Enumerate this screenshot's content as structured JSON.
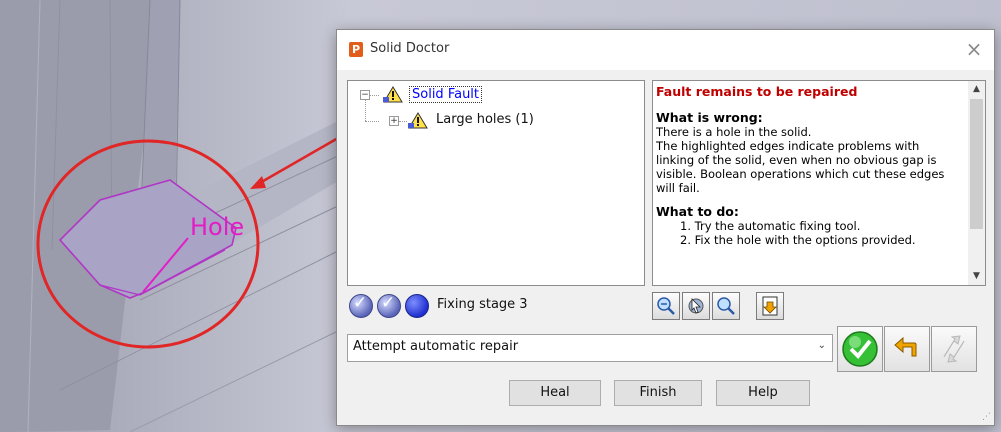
{
  "viewport": {
    "annotation_label": "Hole",
    "colors": {
      "annotation": "#e21ec5",
      "arrow": "#e02626",
      "circle": "#e02626",
      "model": "#c9cad6"
    }
  },
  "dialog": {
    "title": "Solid Doctor",
    "app_icon": "P",
    "close_icon": "×",
    "tree": {
      "root": {
        "label": "Solid Fault",
        "icon": "warning-icon",
        "expander": "−"
      },
      "children": [
        {
          "label": "Large holes (1)",
          "icon": "warning-icon",
          "expander": "+"
        }
      ]
    },
    "info": {
      "title": "Fault remains to be repaired",
      "what_is_wrong_heading": "What is wrong:",
      "what_is_wrong_lines": [
        "There is a hole in the solid.",
        "The highlighted edges indicate problems with linking of the solid, even when no obvious gap is visible. Boolean operations which cut these edges will fail."
      ],
      "what_to_do_heading": "What to do:",
      "what_to_do_items": [
        "1. Try the automatic fixing tool.",
        "2. Fix the hole with the options provided."
      ]
    },
    "stages": {
      "label": "Fixing stage 3",
      "icons": [
        "stage-complete-icon",
        "stage-complete-icon",
        "stage-current-icon"
      ]
    },
    "tools": [
      "zoom-out-icon",
      "select-view-icon",
      "zoom-icon",
      "export-icon"
    ],
    "repair_select": {
      "value": "Attempt automatic repair",
      "arrow": "⌄"
    },
    "action_icons": [
      "apply-check-icon",
      "undo-icon",
      "redo-icon"
    ],
    "buttons": {
      "heal": "Heal",
      "finish": "Finish",
      "help": "Help"
    },
    "colors": {
      "fault_title": "#c00000",
      "selected_label": "#0000ff",
      "apply": "#2db52d",
      "undo": "#f0a400"
    }
  }
}
